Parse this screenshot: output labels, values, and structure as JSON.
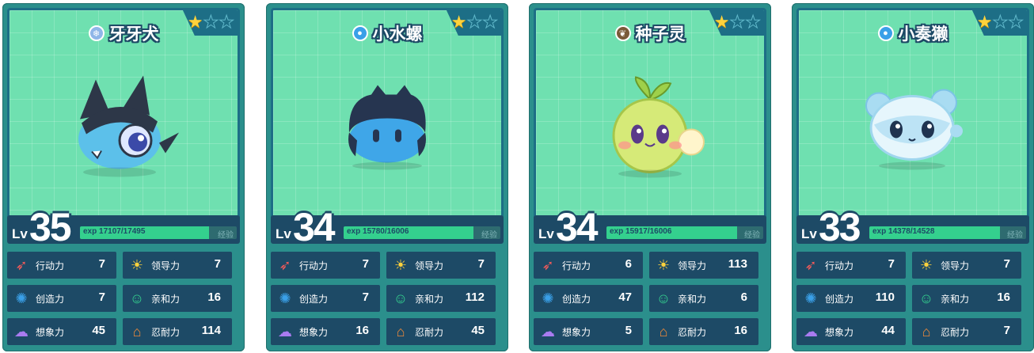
{
  "cards": [
    {
      "name": "牙牙犬",
      "level": "35",
      "exp_current": "17107",
      "exp_max": "/17495",
      "exp_fraction": 0.978,
      "stars_filled": 1,
      "stars_total": 3,
      "element_icon": "ice-icon",
      "element_color": "#8fb6e8",
      "exp_label": "exp",
      "exp_side": "经验",
      "lv_label": "Lv",
      "stats": [
        {
          "label": "行动力",
          "value": "7",
          "icon": "action-icon"
        },
        {
          "label": "领导力",
          "value": "7",
          "icon": "leadership-icon"
        },
        {
          "label": "创造力",
          "value": "7",
          "icon": "creativity-icon"
        },
        {
          "label": "亲和力",
          "value": "16",
          "icon": "affinity-icon"
        },
        {
          "label": "想象力",
          "value": "45",
          "icon": "imagination-icon"
        },
        {
          "label": "忍耐力",
          "value": "114",
          "icon": "endurance-icon"
        }
      ]
    },
    {
      "name": "小水螺",
      "level": "34",
      "exp_current": "15780",
      "exp_max": "/16006",
      "exp_fraction": 0.986,
      "stars_filled": 1,
      "stars_total": 3,
      "element_icon": "water-icon",
      "element_color": "#3aa0e8",
      "exp_label": "exp",
      "exp_side": "经验",
      "lv_label": "Lv",
      "stats": [
        {
          "label": "行动力",
          "value": "7",
          "icon": "action-icon"
        },
        {
          "label": "领导力",
          "value": "7",
          "icon": "leadership-icon"
        },
        {
          "label": "创造力",
          "value": "7",
          "icon": "creativity-icon"
        },
        {
          "label": "亲和力",
          "value": "112",
          "icon": "affinity-icon"
        },
        {
          "label": "想象力",
          "value": "16",
          "icon": "imagination-icon"
        },
        {
          "label": "忍耐力",
          "value": "45",
          "icon": "endurance-icon"
        }
      ]
    },
    {
      "name": "种子灵",
      "level": "34",
      "exp_current": "15917",
      "exp_max": "/16006",
      "exp_fraction": 0.994,
      "stars_filled": 1,
      "stars_total": 3,
      "element_icon": "grass-icon",
      "element_color": "#7a5a38",
      "exp_label": "exp",
      "exp_side": "经验",
      "lv_label": "Lv",
      "stats": [
        {
          "label": "行动力",
          "value": "6",
          "icon": "action-icon"
        },
        {
          "label": "领导力",
          "value": "113",
          "icon": "leadership-icon"
        },
        {
          "label": "创造力",
          "value": "47",
          "icon": "creativity-icon"
        },
        {
          "label": "亲和力",
          "value": "6",
          "icon": "affinity-icon"
        },
        {
          "label": "想象力",
          "value": "5",
          "icon": "imagination-icon"
        },
        {
          "label": "忍耐力",
          "value": "16",
          "icon": "endurance-icon"
        }
      ]
    },
    {
      "name": "小奏獭",
      "level": "33",
      "exp_current": "14378",
      "exp_max": "/14528",
      "exp_fraction": 0.99,
      "stars_filled": 1,
      "stars_total": 3,
      "element_icon": "water-icon",
      "element_color": "#3aa0e8",
      "exp_label": "exp",
      "exp_side": "经验",
      "lv_label": "Lv",
      "stats": [
        {
          "label": "行动力",
          "value": "7",
          "icon": "action-icon"
        },
        {
          "label": "领导力",
          "value": "7",
          "icon": "leadership-icon"
        },
        {
          "label": "创造力",
          "value": "110",
          "icon": "creativity-icon"
        },
        {
          "label": "亲和力",
          "value": "16",
          "icon": "affinity-icon"
        },
        {
          "label": "想象力",
          "value": "44",
          "icon": "imagination-icon"
        },
        {
          "label": "忍耐力",
          "value": "7",
          "icon": "endurance-icon"
        }
      ]
    }
  ],
  "colors": {
    "action": "#f05a5a",
    "leadership": "#ffd23c",
    "creativity": "#3aa0e8",
    "affinity": "#34d08e",
    "imagination": "#a97bf0",
    "endurance": "#f08a3a"
  }
}
